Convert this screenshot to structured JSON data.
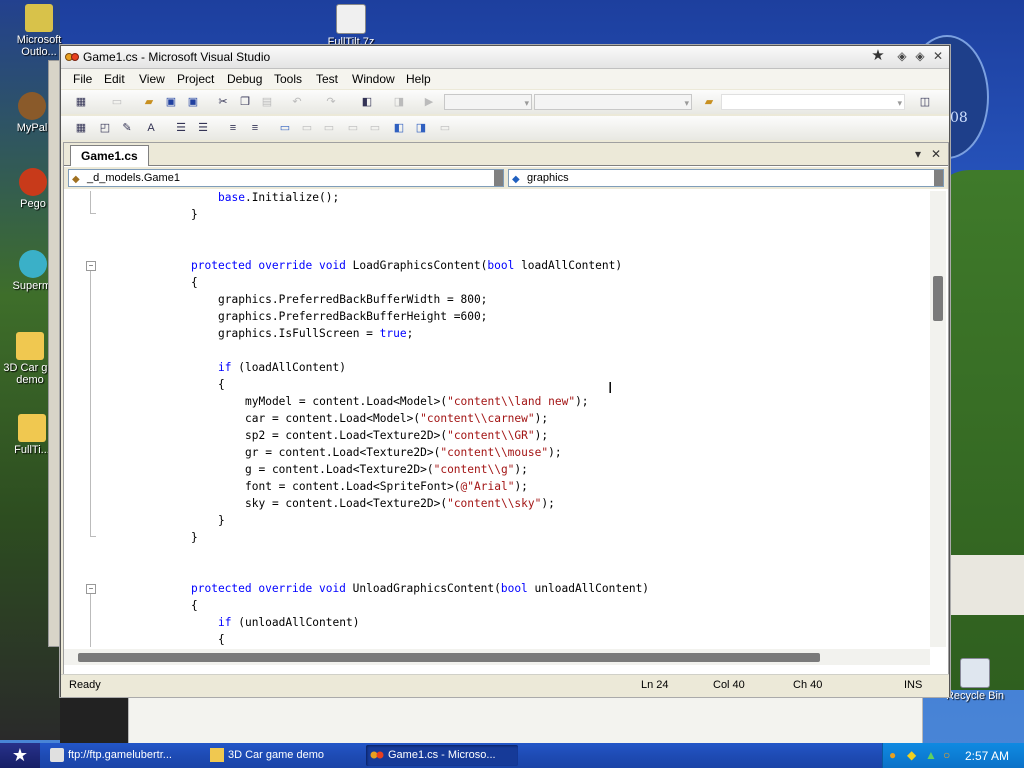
{
  "desktop": {
    "icons": [
      {
        "label": "Microsoft Outlo..."
      },
      {
        "label": "FullTilt.7z"
      },
      {
        "label": "MyPal"
      },
      {
        "label": "Pego"
      },
      {
        "label": "Supermi"
      },
      {
        "label": "3D Car g... demo"
      },
      {
        "label": "FullTi..."
      },
      {
        "label": "Recycle Bin"
      }
    ],
    "logo_text": "08"
  },
  "window": {
    "title": "Game1.cs - Microsoft Visual Studio",
    "controls": {
      "star": "★",
      "min": "◈",
      "max": "◈",
      "close": "✕"
    }
  },
  "menu": [
    "File",
    "Edit",
    "View",
    "Project",
    "Debug",
    "Tools",
    "Test",
    "Window",
    "Help"
  ],
  "document": {
    "tab_label": "Game1.cs",
    "nav_left": "_d_models.Game1",
    "nav_right": "graphics"
  },
  "code": [
    {
      "segments": [
        {
          "t": "base",
          "k": "kw"
        },
        {
          "t": ".Initialize();",
          "k": ""
        }
      ],
      "indent": 8
    },
    {
      "segments": [
        {
          "t": "}",
          "k": ""
        }
      ],
      "indent": 4
    },
    {
      "segments": [],
      "indent": 0
    },
    {
      "segments": [],
      "indent": 0
    },
    {
      "segments": [
        {
          "t": "protected override void",
          "k": "kw"
        },
        {
          "t": " LoadGraphicsContent(",
          "k": ""
        },
        {
          "t": "bool",
          "k": "kw"
        },
        {
          "t": " loadAllContent)",
          "k": ""
        }
      ],
      "indent": 4
    },
    {
      "segments": [
        {
          "t": "{",
          "k": ""
        }
      ],
      "indent": 4
    },
    {
      "segments": [
        {
          "t": "graphics.PreferredBackBufferWidth = 800;",
          "k": ""
        }
      ],
      "indent": 8
    },
    {
      "segments": [
        {
          "t": "graphics.PreferredBackBufferHeight =600;",
          "k": ""
        }
      ],
      "indent": 8
    },
    {
      "segments": [
        {
          "t": "graphics.IsFullScreen = ",
          "k": ""
        },
        {
          "t": "true",
          "k": "kw"
        },
        {
          "t": ";",
          "k": ""
        }
      ],
      "indent": 8
    },
    {
      "segments": [],
      "indent": 0
    },
    {
      "segments": [
        {
          "t": "if",
          "k": "kw"
        },
        {
          "t": " (loadAllContent)",
          "k": ""
        }
      ],
      "indent": 8
    },
    {
      "segments": [
        {
          "t": "{",
          "k": ""
        }
      ],
      "indent": 8
    },
    {
      "segments": [
        {
          "t": "myModel = content.Load<Model>(",
          "k": ""
        },
        {
          "t": "\"content\\\\land new\"",
          "k": "st"
        },
        {
          "t": ");",
          "k": ""
        }
      ],
      "indent": 12
    },
    {
      "segments": [
        {
          "t": "car = content.Load<Model>(",
          "k": ""
        },
        {
          "t": "\"content\\\\carnew\"",
          "k": "st"
        },
        {
          "t": ");",
          "k": ""
        }
      ],
      "indent": 12
    },
    {
      "segments": [
        {
          "t": "sp2 = content.Load<Texture2D>(",
          "k": ""
        },
        {
          "t": "\"content\\\\GR\"",
          "k": "st"
        },
        {
          "t": ");",
          "k": ""
        }
      ],
      "indent": 12
    },
    {
      "segments": [
        {
          "t": "gr = content.Load<Texture2D>(",
          "k": ""
        },
        {
          "t": "\"content\\\\mouse\"",
          "k": "st"
        },
        {
          "t": ");",
          "k": ""
        }
      ],
      "indent": 12
    },
    {
      "segments": [
        {
          "t": "g = content.Load<Texture2D>(",
          "k": ""
        },
        {
          "t": "\"content\\\\g\"",
          "k": "st"
        },
        {
          "t": ");",
          "k": ""
        }
      ],
      "indent": 12
    },
    {
      "segments": [
        {
          "t": "font = content.Load<SpriteFont>(",
          "k": ""
        },
        {
          "t": "@\"Arial\"",
          "k": "st"
        },
        {
          "t": ");",
          "k": ""
        }
      ],
      "indent": 12
    },
    {
      "segments": [
        {
          "t": "sky = content.Load<Texture2D>(",
          "k": ""
        },
        {
          "t": "\"content\\\\sky\"",
          "k": "st"
        },
        {
          "t": ");",
          "k": ""
        }
      ],
      "indent": 12
    },
    {
      "segments": [
        {
          "t": "}",
          "k": ""
        }
      ],
      "indent": 8
    },
    {
      "segments": [
        {
          "t": "}",
          "k": ""
        }
      ],
      "indent": 4
    },
    {
      "segments": [],
      "indent": 0
    },
    {
      "segments": [],
      "indent": 0
    },
    {
      "segments": [
        {
          "t": "protected override void",
          "k": "kw"
        },
        {
          "t": " UnloadGraphicsContent(",
          "k": ""
        },
        {
          "t": "bool",
          "k": "kw"
        },
        {
          "t": " unloadAllContent)",
          "k": ""
        }
      ],
      "indent": 4
    },
    {
      "segments": [
        {
          "t": "{",
          "k": ""
        }
      ],
      "indent": 4
    },
    {
      "segments": [
        {
          "t": "if",
          "k": "kw"
        },
        {
          "t": " (unloadAllContent)",
          "k": ""
        }
      ],
      "indent": 8
    },
    {
      "segments": [
        {
          "t": "{",
          "k": ""
        }
      ],
      "indent": 8
    }
  ],
  "status": {
    "ready": "Ready",
    "ln": "Ln 24",
    "col": "Col 40",
    "ch": "Ch 40",
    "mode": "INS"
  },
  "taskbar": {
    "buttons": [
      {
        "label": "ftp://ftp.gamelubertr..."
      },
      {
        "label": "3D Car game demo"
      },
      {
        "label": "Game1.cs - Microso..."
      }
    ],
    "clock": "2:57 AM"
  },
  "colors": {
    "keyword": "#0000ff",
    "string": "#a31515",
    "taskbar": "#1e4bb4"
  }
}
